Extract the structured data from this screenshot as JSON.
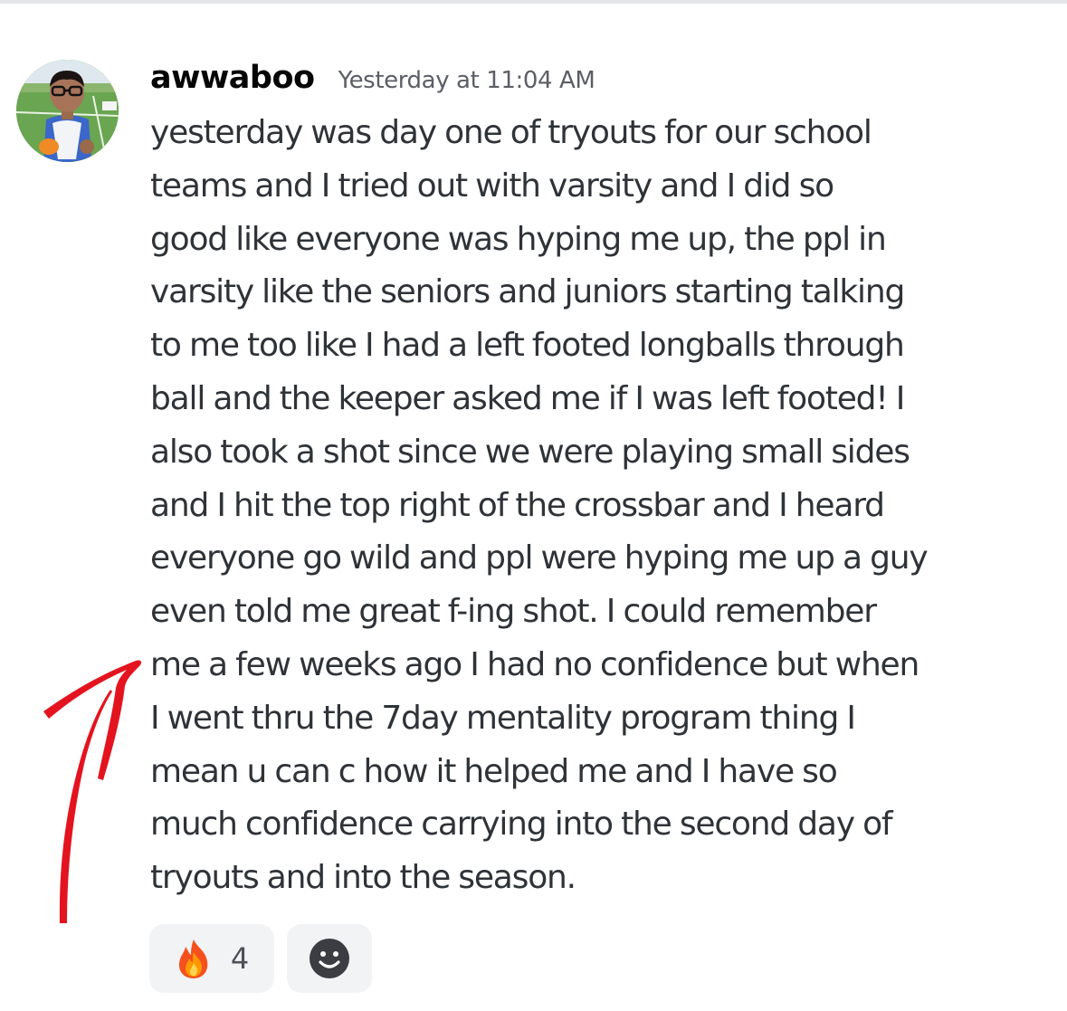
{
  "message": {
    "author": "awwaboo",
    "timestamp": "Yesterday at 11:04 AM",
    "content_lines": [
      "yesterday was day one of tryouts for our school",
      "teams and I tried out with varsity and I did so",
      "good like everyone was hyping me up, the ppl in",
      "varsity like the seniors and juniors starting talking",
      "to me too like I had a left footed longballs through",
      "ball and the keeper asked me if I was left footed! I",
      "also took a shot since we were playing small sides",
      "and I hit the top right of the crossbar and I heard",
      "everyone go wild and ppl were hyping me up a guy",
      "even told me great f-ing shot. I could remember",
      "me a few weeks ago I had no confidence but when",
      "I went thru the 7day mentality program thing I",
      "mean u can c how it helped me and I have so",
      "much confidence carrying into the second day of",
      "tryouts and into the season."
    ]
  },
  "reactions": [
    {
      "icon": "fire-emoji-icon",
      "count": "4"
    },
    {
      "icon": "add-reaction-smiley-icon"
    }
  ],
  "annotation": {
    "icon": "red-arrow-icon",
    "color": "#e3141f"
  },
  "colors": {
    "author": "#060607",
    "timestamp": "#5c5e66",
    "body_text": "#2e3338",
    "reaction_bg": "#f2f3f5"
  }
}
